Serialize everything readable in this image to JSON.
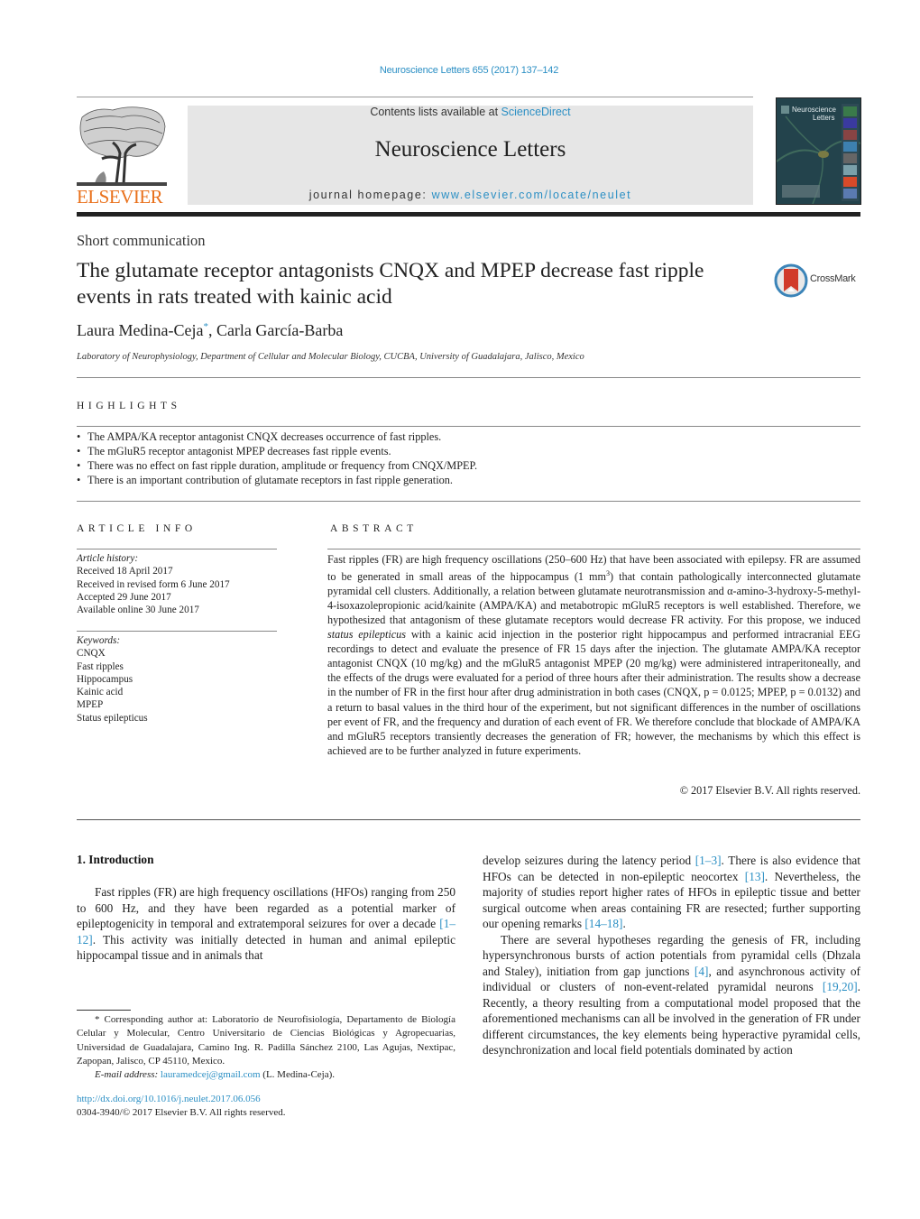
{
  "header": {
    "journal_reference": "Neuroscience Letters 655 (2017) 137–142",
    "contents_prefix": "Contents lists available at ",
    "contents_link": "ScienceDirect",
    "journal_title": "Neuroscience Letters",
    "homepage_prefix": "journal homepage: ",
    "homepage_link": "www.elsevier.com/locate/neulet",
    "publisher_logo_text": "ELSEVIER",
    "cover_title_line1": "Neuroscience",
    "cover_title_line2": "Letters",
    "colors": {
      "link": "#2b8fc4",
      "elsevier_orange": "#e9711c",
      "banner_bg": "#e6e6e6"
    }
  },
  "article": {
    "type": "Short communication",
    "title": "The glutamate receptor antagonists CNQX and MPEP decrease fast ripple events in rats treated with kainic acid",
    "crossmark_label": "CrossMark",
    "authors": [
      {
        "name": "Laura Medina-Ceja",
        "mark": "*"
      },
      {
        "name": "Carla García-Barba",
        "mark": ""
      }
    ],
    "author_separator": ", ",
    "affiliation": "Laboratory of Neurophysiology, Department of Cellular and Molecular Biology, CUCBA, University of Guadalajara, Jalisco, Mexico"
  },
  "highlights": {
    "heading": "HIGHLIGHTS",
    "items": [
      "The AMPA/KA receptor antagonist CNQX decreases occurrence of fast ripples.",
      "The mGluR5 receptor antagonist MPEP decreases fast ripple events.",
      "There was no effect on fast ripple duration, amplitude or frequency from CNQX/MPEP.",
      "There is an important contribution of glutamate receptors in fast ripple generation."
    ]
  },
  "article_info": {
    "heading": "ARTICLE INFO",
    "history_label": "Article history:",
    "history": [
      "Received 18 April 2017",
      "Received in revised form 6 June 2017",
      "Accepted 29 June 2017",
      "Available online 30 June 2017"
    ],
    "keywords_label": "Keywords:",
    "keywords": [
      "CNQX",
      "Fast ripples",
      "Hippocampus",
      "Kainic acid",
      "MPEP",
      "Status epilepticus"
    ]
  },
  "abstract": {
    "heading": "ABSTRACT",
    "part1": "Fast ripples (FR) are high frequency oscillations (250–600 Hz) that have been associated with epilepsy. FR are assumed to be generated in small areas of the hippocampus (1 mm",
    "sup": "3",
    "part2": ") that contain pathologically interconnected glutamate pyramidal cell clusters. Additionally, a relation between glutamate neurotransmission and α-amino-3-hydroxy-5-methyl-4-isoxazolepropionic acid/kainite (AMPA/KA) and metabotropic mGluR5 receptors is well established. Therefore, we hypothesized that antagonism of these glutamate receptors would decrease FR activity. For this propose, we induced ",
    "italic": "status epilepticus",
    "part3": " with a kainic acid injection in the posterior right hippocampus and performed intracranial EEG recordings to detect and evaluate the presence of FR 15 days after the injection. The glutamate AMPA/KA receptor antagonist CNQX (10 mg/kg) and the mGluR5 antagonist MPEP (20 mg/kg) were administered intraperitoneally, and the effects of the drugs were evaluated for a period of three hours after their administration. The results show a decrease in the number of FR in the first hour after drug administration in both cases (CNQX, p = 0.0125; MPEP, p = 0.0132) and a return to basal values in the third hour of the experiment, but not significant differences in the number of oscillations per event of FR, and the frequency and duration of each event of FR. We therefore conclude that blockade of AMPA/KA and mGluR5 receptors transiently decreases the generation of FR; however, the mechanisms by which this effect is achieved are to be further analyzed in future experiments.",
    "copyright": "© 2017 Elsevier B.V. All rights reserved."
  },
  "introduction": {
    "heading": "1.  Introduction",
    "left_p1_a": "Fast ripples (FR) are high frequency oscillations (HFOs) ranging from 250 to 600 Hz, and they have been regarded as a potential marker of epileptogenicity in temporal and extratemporal seizures for over a decade ",
    "left_p1_ref": "[1–12]",
    "left_p1_b": ". This activity was initially detected in human and animal epileptic hippocampal tissue and in animals that",
    "right_p1_a": "develop seizures during the latency period ",
    "right_p1_ref1": "[1–3]",
    "right_p1_b": ". There is also evidence that HFOs can be detected in non-epileptic neocortex ",
    "right_p1_ref2": "[13]",
    "right_p1_c": ". Nevertheless, the majority of studies report higher rates of HFOs in epileptic tissue and better surgical outcome when areas containing FR are resected; further supporting our opening remarks ",
    "right_p1_ref3": "[14–18]",
    "right_p1_d": ".",
    "right_p2_a": "There are several hypotheses regarding the genesis of FR, including hypersynchronous bursts of action potentials from pyramidal cells (Dhzala and Staley), initiation from gap junctions ",
    "right_p2_ref1": "[4]",
    "right_p2_b": ", and asynchronous activity of individual or clusters of non-event-related pyramidal neurons ",
    "right_p2_ref2": "[19,20]",
    "right_p2_c": ". Recently, a theory resulting from a computational model proposed that the aforementioned mechanisms can all be involved in the generation of FR under different circumstances, the key elements being hyperactive pyramidal cells, desynchronization and local field potentials dominated by action"
  },
  "footnote": {
    "text": "* Corresponding author at: Laboratorio de Neurofisiología, Departamento de Biología Celular y Molecular, Centro Universitario de Ciencias Biológicas y Agropecuarias, Universidad de Guadalajara, Camino Ing. R. Padilla Sánchez 2100, Las Agujas, Nextipac, Zapopan, Jalisco, CP 45110, Mexico.",
    "email_label": "E-mail address: ",
    "email": "lauramedcej@gmail.com",
    "email_owner": " (L. Medina-Ceja)."
  },
  "footer": {
    "doi": "http://dx.doi.org/10.1016/j.neulet.2017.06.056",
    "issn_line": "0304-3940/© 2017 Elsevier B.V. All rights reserved."
  }
}
